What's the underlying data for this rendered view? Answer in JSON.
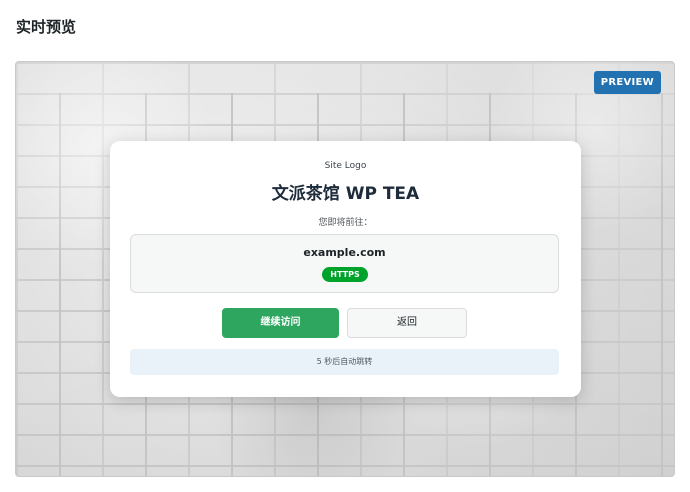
{
  "page": {
    "section_title": "实时预览"
  },
  "preview": {
    "badge": "PREVIEW",
    "card": {
      "site_logo": "Site Logo",
      "site_name": "文派茶馆 WP TEA",
      "going_to_label": "您即将前往：",
      "url": "example.com",
      "protocol_badge": "HTTPS",
      "continue_button": "继续访问",
      "back_button": "返回",
      "countdown_text": "5 秒后自动跳转"
    }
  },
  "colors": {
    "badge_bg": "#2271b1",
    "https_green": "#00a32a",
    "continue_green": "#2ea660",
    "countdown_bg": "#eaf2f9"
  }
}
